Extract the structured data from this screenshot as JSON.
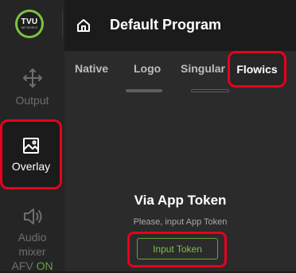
{
  "brand": {
    "logo_text": "TVU",
    "logo_subtext": "NETWORKS",
    "accent_color": "#7cc242",
    "highlight_color": "#e8001c"
  },
  "header": {
    "title": "Default Program",
    "home_icon": "home-icon"
  },
  "sidebar": {
    "items": [
      {
        "label": "Output",
        "icon": "output-icon"
      },
      {
        "label": "Overlay",
        "icon": "overlay-icon",
        "active": true
      },
      {
        "label_line1": "Audio",
        "label_line2": "mixer",
        "label_line3": "AFV",
        "status": "ON",
        "icon": "speaker-icon"
      }
    ]
  },
  "tabs": [
    {
      "label": "Native"
    },
    {
      "label": "Logo"
    },
    {
      "label": "Singular"
    },
    {
      "label": "Flowics",
      "active": true
    }
  ],
  "content": {
    "title": "Via App Token",
    "subtitle": "Please, input App Token",
    "button_label": "Input Token"
  }
}
